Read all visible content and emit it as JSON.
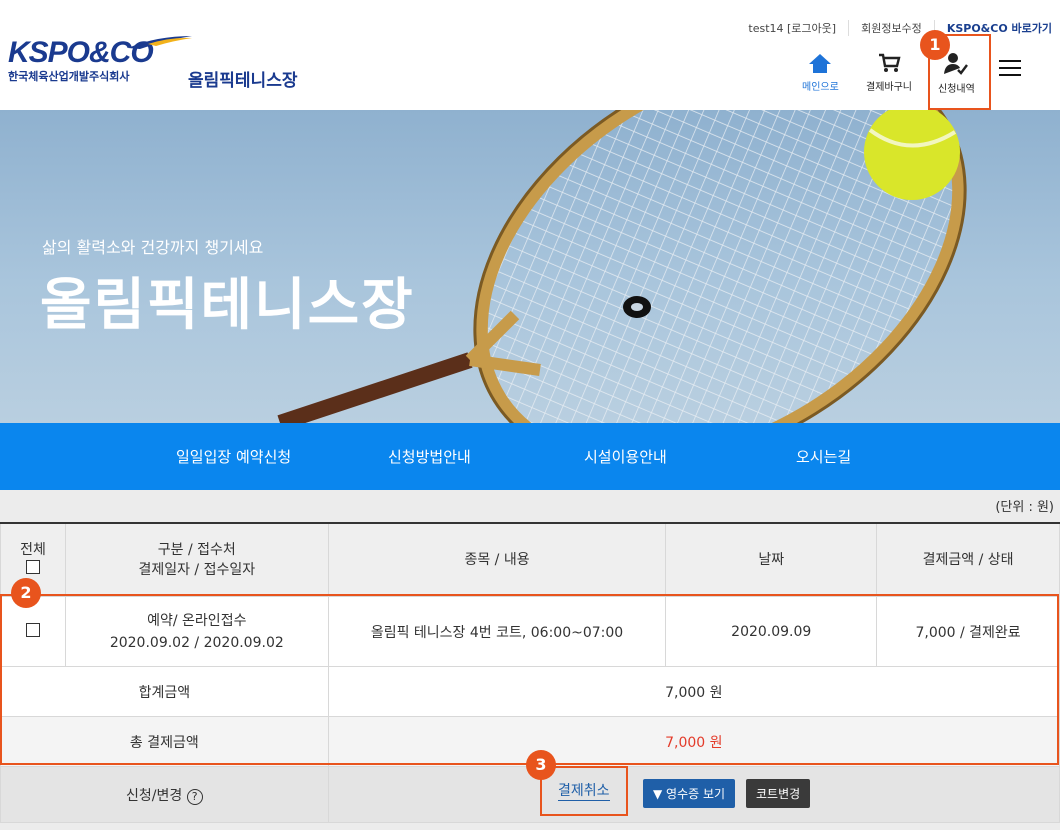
{
  "util": {
    "user": "test14 [로그아웃]",
    "edit": "회원정보수정",
    "kspo": "KSPO&CO 바로가기"
  },
  "logo": {
    "main": "KSPO&CO",
    "sub": "한국체육산업개발주식회사"
  },
  "site_title": "올림픽테니스장",
  "header_icons": {
    "home": "메인으로",
    "cart": "결제바구니",
    "history": "신청내역"
  },
  "hero": {
    "subtitle": "삶의 활력소와 건강까지 챙기세요",
    "title": "올림픽테니스장"
  },
  "nav": [
    "일일입장 예약신청",
    "신청방법안내",
    "시설이용안내",
    "오시는길"
  ],
  "unit": "(단위 : 원)",
  "table": {
    "headers": {
      "all": "전체",
      "cat1": "구분 / 접수처",
      "cat2": "결제일자 / 접수일자",
      "item": "종목 / 내용",
      "date": "날짜",
      "amount": "결제금액 / 상태"
    },
    "row": {
      "type": "예약/ 온라인접수",
      "dates": "2020.09.02 / 2020.09.02",
      "content": "올림픽 테니스장 4번 코트, 06:00~07:00",
      "date": "2020.09.09",
      "amount": "7,000 / 결제완료"
    },
    "sum_label": "합계금액",
    "sum_value": "7,000 원",
    "total_label": "총 결제금액",
    "total_value": "7,000 원",
    "change_label": "신청/변경"
  },
  "buttons": {
    "cancel": "결제취소",
    "receipt": "▼ 영수증 보기",
    "court": "코트변경"
  },
  "badges": [
    "1",
    "2",
    "3"
  ],
  "colors": {
    "accent": "#e8541d",
    "nav": "#0a86ee",
    "brand": "#1a3a8f",
    "receipt": "#1f5fa8",
    "court": "#3a3a3a"
  }
}
